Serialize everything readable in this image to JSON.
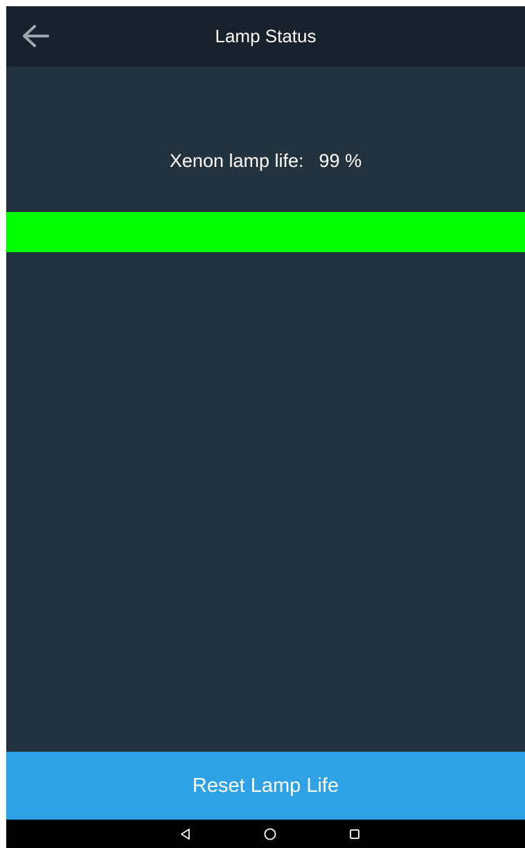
{
  "app_bar": {
    "title": "Lamp Status",
    "back_icon": "arrow-left-icon"
  },
  "lamp": {
    "label": "Xenon lamp life:",
    "value_text": "99 %",
    "life_fraction": 0.99
  },
  "actions": {
    "reset_label": "Reset Lamp Life"
  },
  "system_nav": {
    "back_icon": "nav-back-triangle-icon",
    "home_icon": "nav-home-circle-icon",
    "recents_icon": "nav-recents-square-icon"
  },
  "colors": {
    "app_bar_bg": "#17222d",
    "content_bg": "#22333f",
    "progress_fill": "#00ff00",
    "button_bg": "#2ea2e5",
    "nav_bg": "#000000"
  }
}
